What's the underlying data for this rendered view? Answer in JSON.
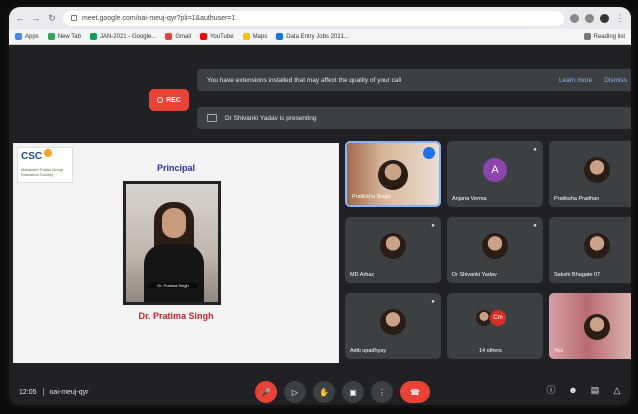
{
  "browser": {
    "url": "meet.google.com/oai-meuj-qyr?pli=1&authuser=1",
    "bookmarks": [
      "Apps",
      "New Tab",
      "JAN-2021 - Google...",
      "Gmail",
      "YouTube",
      "Maps",
      "Data Entry Jobs 2021..."
    ],
    "bookmarks_right": "Reading list"
  },
  "meet": {
    "rec_label": "REC",
    "banner_text": "You have extensions installed that may affect the quality of your call",
    "banner_links": [
      "Learn more",
      "Dismiss"
    ],
    "presenting_text": "Dr Shivanki Yadav is presenting",
    "time": "12:05",
    "meeting_code": "oai-meuj-qyr"
  },
  "shared_screen": {
    "logo": "CSC",
    "logo_sub": "Mahaveer Public Group Education Society",
    "heading": "Principal",
    "photo_caption": "Dr. Pratima Singh",
    "name": "Dr. Pratima Singh"
  },
  "participants": [
    {
      "name": "Pratiksha Singh",
      "kind": "video",
      "active": true
    },
    {
      "name": "Anjana Verma",
      "kind": "letter",
      "letter": "A"
    },
    {
      "name": "Pratiksha Pradhan",
      "kind": "photo"
    },
    {
      "name": "MD Arbaz",
      "kind": "photo"
    },
    {
      "name": "Dr Shivanki Yadav",
      "kind": "photo"
    },
    {
      "name": "Sakshi Bhagate 07",
      "kind": "photo"
    },
    {
      "name": "Aditi upadhyay",
      "kind": "photo"
    },
    {
      "name": "14 others",
      "kind": "others",
      "badge": "Cm"
    },
    {
      "name": "Yes",
      "kind": "video2"
    }
  ]
}
